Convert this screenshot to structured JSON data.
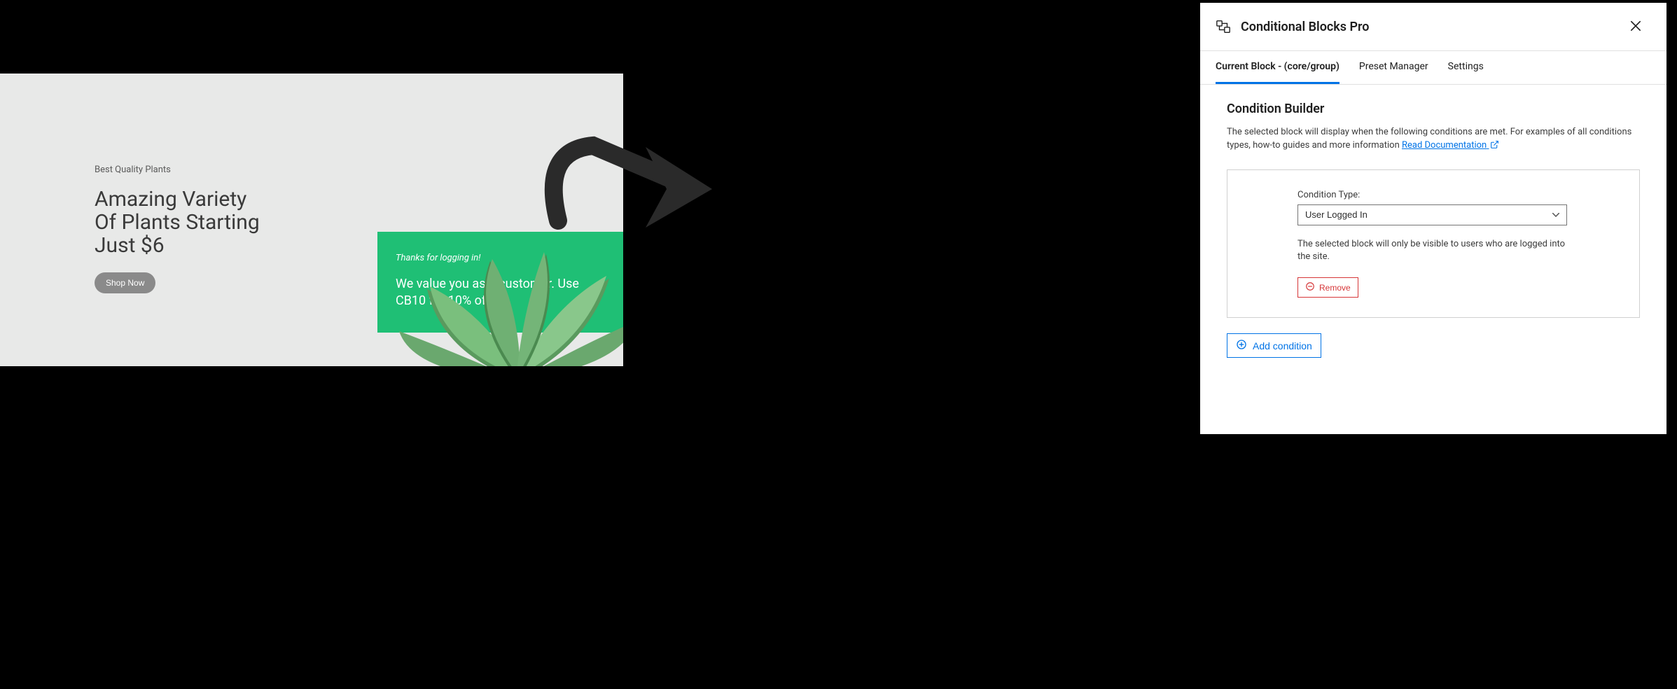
{
  "hero": {
    "eyebrow": "Best Quality Plants",
    "title_line1": "Amazing Variety",
    "title_line2": "Of Plants Starting",
    "title_line3": "Just $6",
    "cta": "Shop Now"
  },
  "promo": {
    "thanks": "Thanks for logging in!",
    "body": "We value you as a customer. Use CB10 for 10% off"
  },
  "modal": {
    "title": "Conditional Blocks Pro",
    "tabs": {
      "current": "Current Block - (core/group)",
      "preset": "Preset Manager",
      "settings": "Settings"
    },
    "builder": {
      "title": "Condition Builder",
      "description_pre": "The selected block will display when the following conditions are met. For examples of all conditions types, how-to guides and more information ",
      "doc_link": "Read Documentation",
      "condition": {
        "type_label": "Condition Type:",
        "type_value": "User Logged In",
        "help": "The selected block will only be visible to users who are logged into the site.",
        "remove": "Remove"
      },
      "add": "Add condition"
    }
  }
}
